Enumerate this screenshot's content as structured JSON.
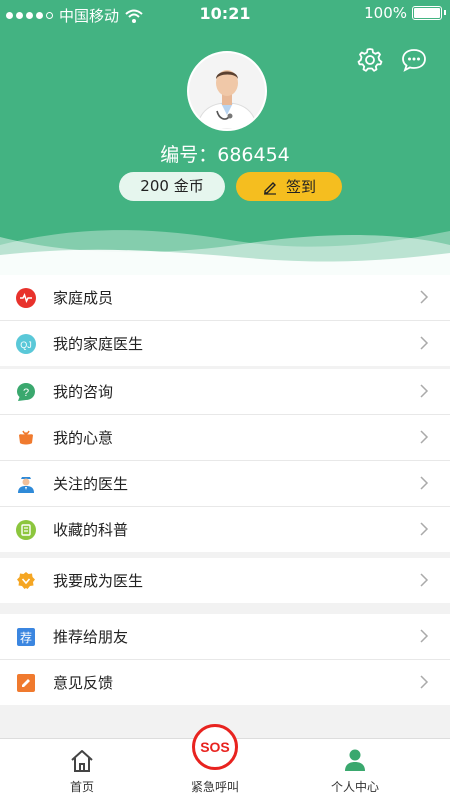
{
  "status_bar": {
    "carrier": "中国移动",
    "time": "10:21",
    "battery": "100%"
  },
  "profile": {
    "id_label": "编号：",
    "id_value": "686454",
    "coins": "200 金币",
    "signin": "签到"
  },
  "colors": {
    "brand": "#43b382",
    "accent": "#f5be1f",
    "sos": "#e8231f"
  },
  "menu_groups": [
    [
      {
        "label": "家庭成员",
        "icon": "heart-pulse-icon"
      },
      {
        "label": "我的家庭医生",
        "icon": "family-doctor-icon"
      }
    ],
    [
      {
        "label": "我的咨询",
        "icon": "question-bubble-icon"
      },
      {
        "label": "我的心意",
        "icon": "gift-flower-icon"
      },
      {
        "label": "关注的医生",
        "icon": "doctor-icon"
      },
      {
        "label": "收藏的科普",
        "icon": "bookmark-doc-icon"
      }
    ],
    [
      {
        "label": "我要成为医生",
        "icon": "badge-icon"
      }
    ],
    [
      {
        "label": "推荐给朋友",
        "icon": "recommend-icon"
      },
      {
        "label": "意见反馈",
        "icon": "feedback-icon"
      }
    ]
  ],
  "tabbar": {
    "home": "首页",
    "sos_text": "SOS",
    "emergency": "紧急呼叫",
    "profile": "个人中心"
  }
}
